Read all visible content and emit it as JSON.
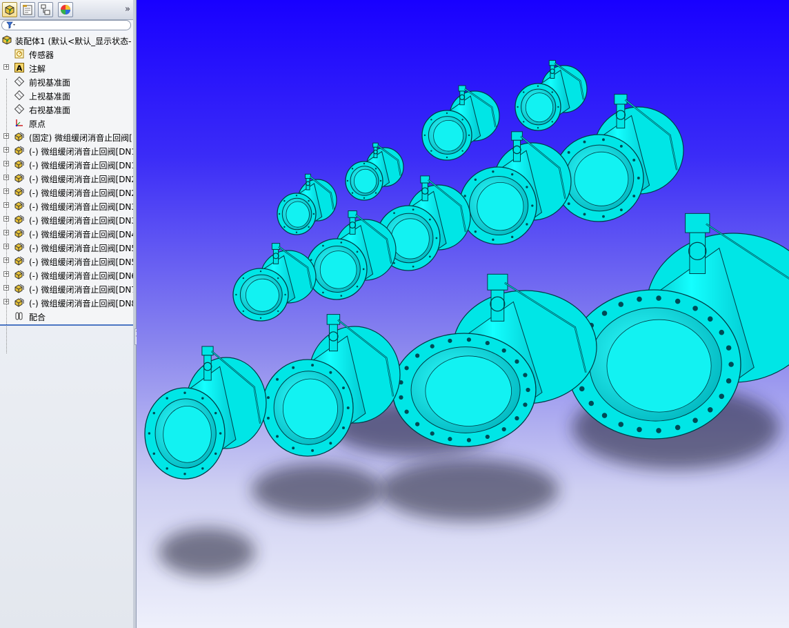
{
  "panel": {
    "tabs": [
      {
        "name": "featuremanager-tab-icon",
        "active": true
      },
      {
        "name": "propertymanager-tab-icon",
        "active": false
      },
      {
        "name": "configurationmanager-tab-icon",
        "active": false
      },
      {
        "name": "displaymanager-tab-icon",
        "active": false
      }
    ],
    "expand_label": "»",
    "filter_icon": "▼"
  },
  "tree": {
    "root": "装配体1  (默认<默认_显示状态-",
    "items": [
      {
        "label": "传感器",
        "icon": "sensor-icon",
        "expandable": false
      },
      {
        "label": "注解",
        "icon": "annotation-icon",
        "expandable": true
      },
      {
        "label": "前视基准面",
        "icon": "plane-icon",
        "expandable": false
      },
      {
        "label": "上视基准面",
        "icon": "plane-icon",
        "expandable": false
      },
      {
        "label": "右视基准面",
        "icon": "plane-icon",
        "expandable": false
      },
      {
        "label": "原点",
        "icon": "origin-icon",
        "expandable": false
      },
      {
        "label": "(固定) 微组缓闭消音止回阀[I",
        "icon": "part-icon",
        "expandable": true
      },
      {
        "label": "(-) 微组缓闭消音止回阀[DN1",
        "icon": "part-icon",
        "expandable": true
      },
      {
        "label": "(-) 微组缓闭消音止回阀[DN1",
        "icon": "part-icon",
        "expandable": true
      },
      {
        "label": "(-) 微组缓闭消音止回阀[DN2",
        "icon": "part-icon",
        "expandable": true
      },
      {
        "label": "(-) 微组缓闭消音止回阀[DN2",
        "icon": "part-icon",
        "expandable": true
      },
      {
        "label": "(-) 微组缓闭消音止回阀[DN3",
        "icon": "part-icon",
        "expandable": true
      },
      {
        "label": "(-) 微组缓闭消音止回阀[DN3",
        "icon": "part-icon",
        "expandable": true
      },
      {
        "label": "(-) 微组缓闭消音止回阀[DN4",
        "icon": "part-icon",
        "expandable": true
      },
      {
        "label": "(-) 微组缓闭消音止回阀[DN5",
        "icon": "part-icon",
        "expandable": true
      },
      {
        "label": "(-) 微组缓闭消音止回阀[DN5",
        "icon": "part-icon",
        "expandable": true
      },
      {
        "label": "(-) 微组缓闭消音止回阀[DN6",
        "icon": "part-icon",
        "expandable": true
      },
      {
        "label": "(-) 微组缓闭消音止回阀[DN7",
        "icon": "part-icon",
        "expandable": true
      },
      {
        "label": "(-) 微组缓闭消音止回阀[DN8",
        "icon": "part-icon",
        "expandable": true
      },
      {
        "label": "配合",
        "icon": "mates-icon",
        "expandable": false
      }
    ]
  },
  "colors": {
    "valve_body": "#00e6e6",
    "valve_edge": "#003c46",
    "background_top": "#1800ff",
    "background_bottom": "#eef0fb"
  },
  "viewport": {
    "content": "3D assembly of 14 check valves of varying sizes (DN series)",
    "valve_count": 14
  }
}
